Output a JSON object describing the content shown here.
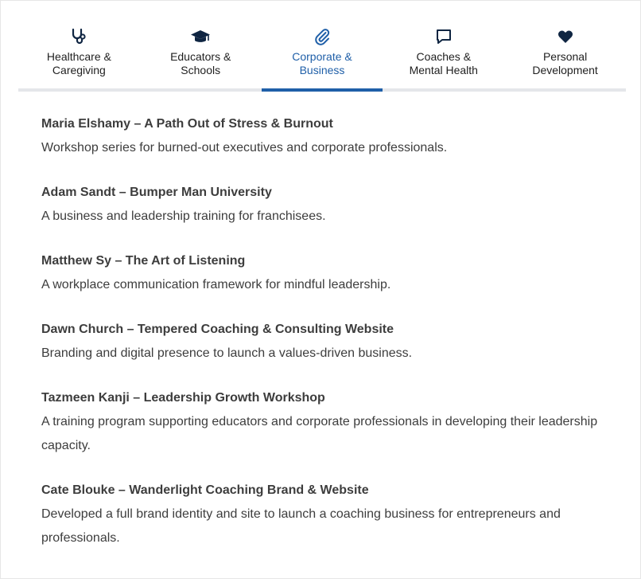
{
  "tabs": [
    {
      "label_line1": "Healthcare &",
      "label_line2": "Caregiving",
      "icon": "stethoscope-icon",
      "active": false
    },
    {
      "label_line1": "Educators &",
      "label_line2": "Schools",
      "icon": "graduation-cap-icon",
      "active": false
    },
    {
      "label_line1": "Corporate &",
      "label_line2": "Business",
      "icon": "paperclip-icon",
      "active": true
    },
    {
      "label_line1": "Coaches &",
      "label_line2": "Mental Health",
      "icon": "speech-bubble-icon",
      "active": false
    },
    {
      "label_line1": "Personal",
      "label_line2": "Development",
      "icon": "heart-icon",
      "active": false
    }
  ],
  "colors": {
    "accent": "#1f5fa8",
    "icon_dark": "#0f2542",
    "text": "#3d3d3d"
  },
  "entries": [
    {
      "title": "Maria Elshamy – A Path Out of Stress & Burnout",
      "desc": "Workshop series for burned-out executives and corporate professionals."
    },
    {
      "title": "Adam Sandt – Bumper Man University",
      "desc": "A business and leadership training for franchisees."
    },
    {
      "title": "Matthew Sy – The Art of Listening",
      "desc": "A workplace communication framework for mindful leadership."
    },
    {
      "title": "Dawn Church – Tempered Coaching & Consulting Website",
      "desc": "Branding and digital presence to launch a values-driven business."
    },
    {
      "title": "Tazmeen Kanji – Leadership Growth Workshop",
      "desc": "A training program supporting educators and corporate professionals in developing their leadership capacity."
    },
    {
      "title": "Cate Blouke – Wanderlight Coaching Brand & Website",
      "desc": "Developed a full brand identity and site to launch a coaching business for entrepreneurs and professionals."
    }
  ]
}
